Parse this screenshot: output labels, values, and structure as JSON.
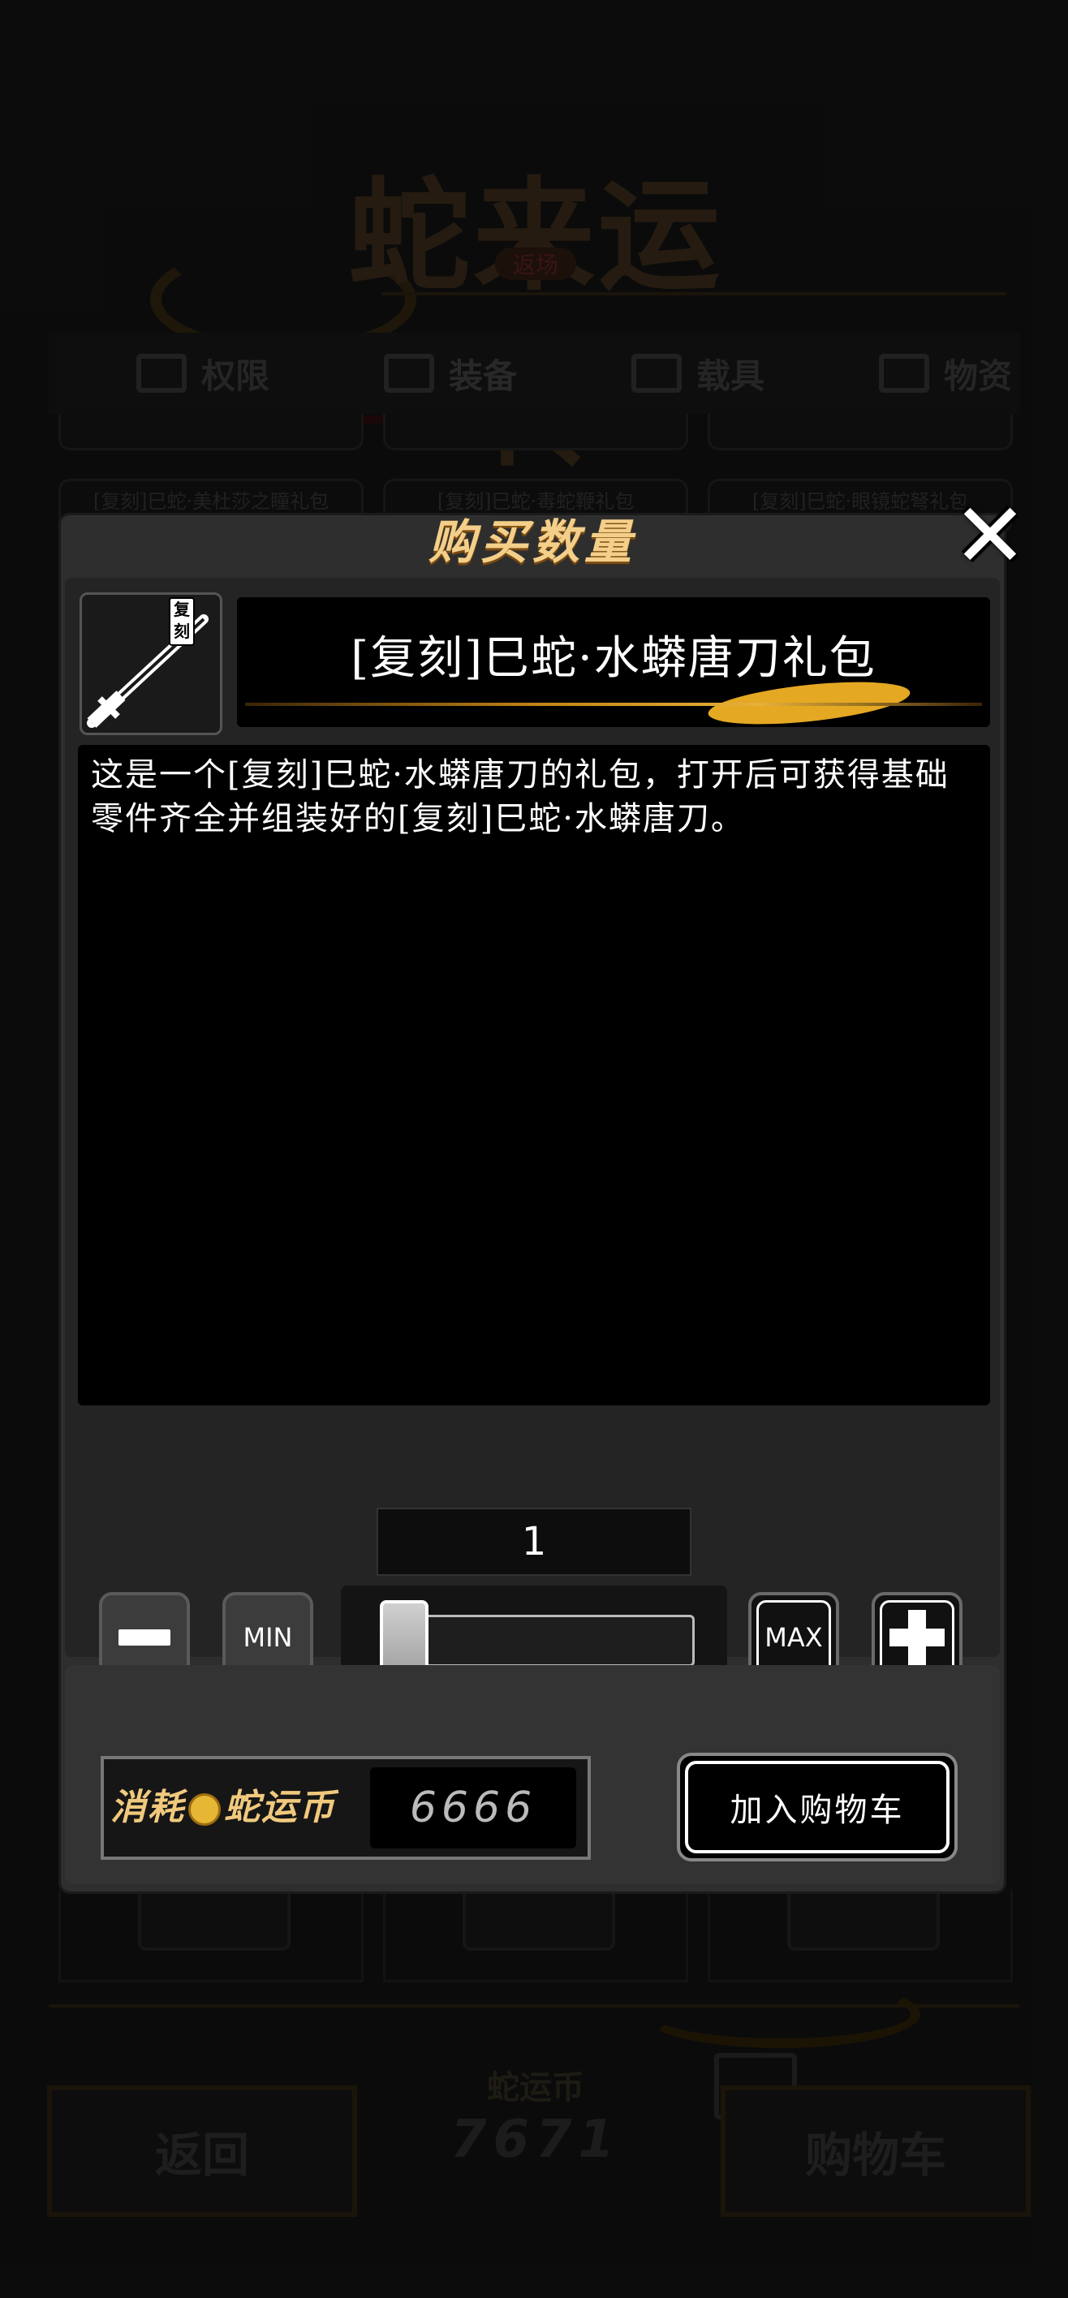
{
  "background": {
    "title": "蛇来运转",
    "subtitle": "返场",
    "tabs": [
      {
        "label": "权限"
      },
      {
        "label": "装备"
      },
      {
        "label": "载具"
      },
      {
        "label": "物资"
      }
    ],
    "cards": [
      {
        "label": "[复刻]巳蛇·美杜莎之瞳礼包"
      },
      {
        "label": "[复刻]巳蛇·毒蛇鞭礼包"
      },
      {
        "label": "[复刻]巳蛇·眼镜蛇弩礼包"
      }
    ],
    "currency_label": "蛇运币",
    "currency_value": "7671",
    "back_button": "返回",
    "cart_button": "购物车"
  },
  "dialog": {
    "title": "购买数量",
    "close_icon": "close-icon",
    "item_badge": "复刻",
    "item_name": "[复刻]巳蛇·水蟒唐刀礼包",
    "description": "这是一个[复刻]巳蛇·水蟒唐刀的礼包，打开后可获得基础零件齐全并组装好的[复刻]巳蛇·水蟒唐刀。",
    "quantity": "1",
    "min_label": "MIN",
    "max_label": "MAX",
    "slider_value": 0.0,
    "cost_label_prefix": "消耗",
    "cost_currency": "蛇运币",
    "cost_value": "6666",
    "add_to_cart_label": "加入购物车"
  },
  "colors": {
    "accent_gold": "#f3cf8a",
    "coin": "#e6b735",
    "panel": "#2e2e2e"
  }
}
